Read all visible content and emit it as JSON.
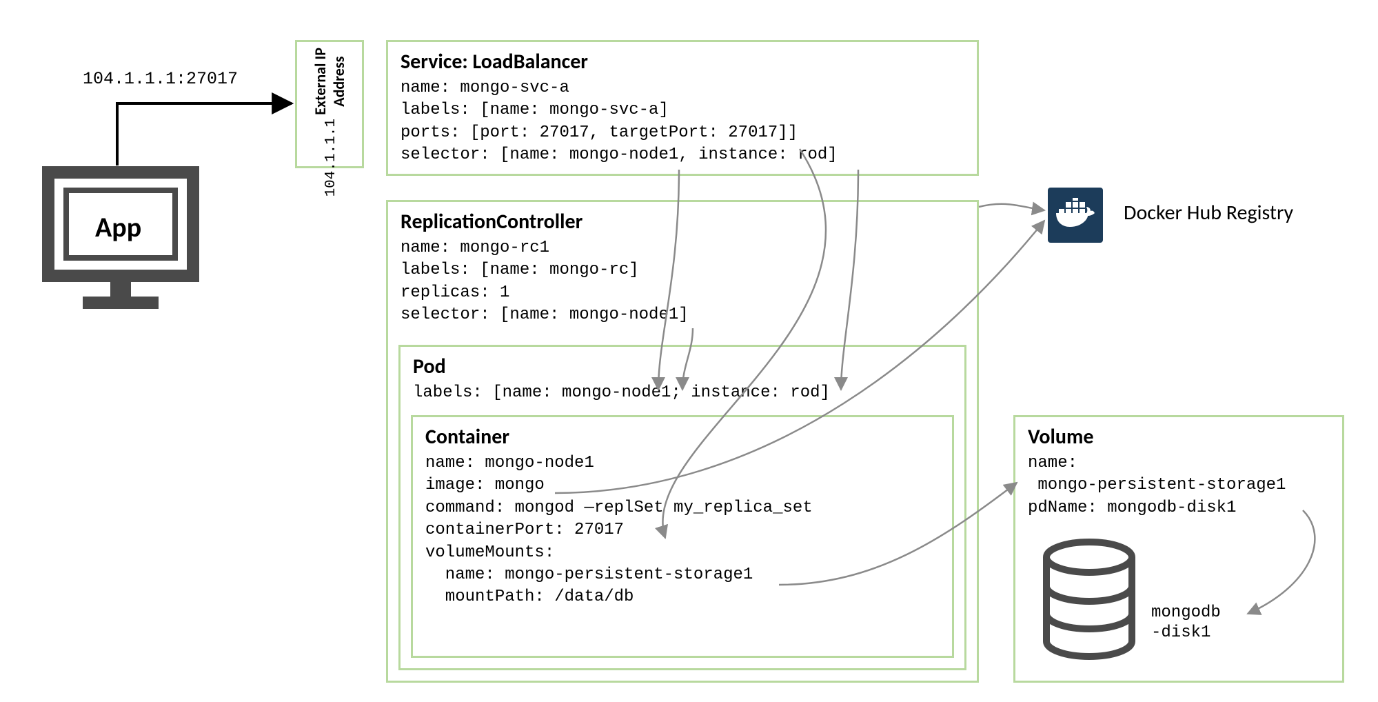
{
  "connection": {
    "ip_port": "104.1.1.1:27017",
    "external_ip_label": "External IP\nAddress",
    "external_ip_value": "104.1.1.1"
  },
  "app": {
    "label": "App"
  },
  "service": {
    "title": "Service: LoadBalancer",
    "body": "name: mongo-svc-a\nlabels: [name: mongo-svc-a]\nports: [port: 27017, targetPort: 27017]]\nselector: [name: mongo-node1, instance: rod]"
  },
  "rc": {
    "title": "ReplicationController",
    "body": "name: mongo-rc1\nlabels: [name: mongo-rc]\nreplicas: 1\nselector: [name: mongo-node1]"
  },
  "pod": {
    "title": "Pod",
    "body": "labels: [name: mongo-node1; instance: rod]"
  },
  "container": {
    "title": "Container",
    "body": "name: mongo-node1\nimage: mongo\ncommand: mongod —replSet my_replica_set\ncontainerPort: 27017\nvolumeMounts:\n  name: mongo-persistent-storage1\n  mountPath: /data/db"
  },
  "volume": {
    "title": "Volume",
    "body": "name:\n mongo-persistent-storage1\npdName: mongodb-disk1"
  },
  "docker": {
    "label": "Docker Hub Registry"
  },
  "disk": {
    "label": "mongodb\n-disk1"
  }
}
